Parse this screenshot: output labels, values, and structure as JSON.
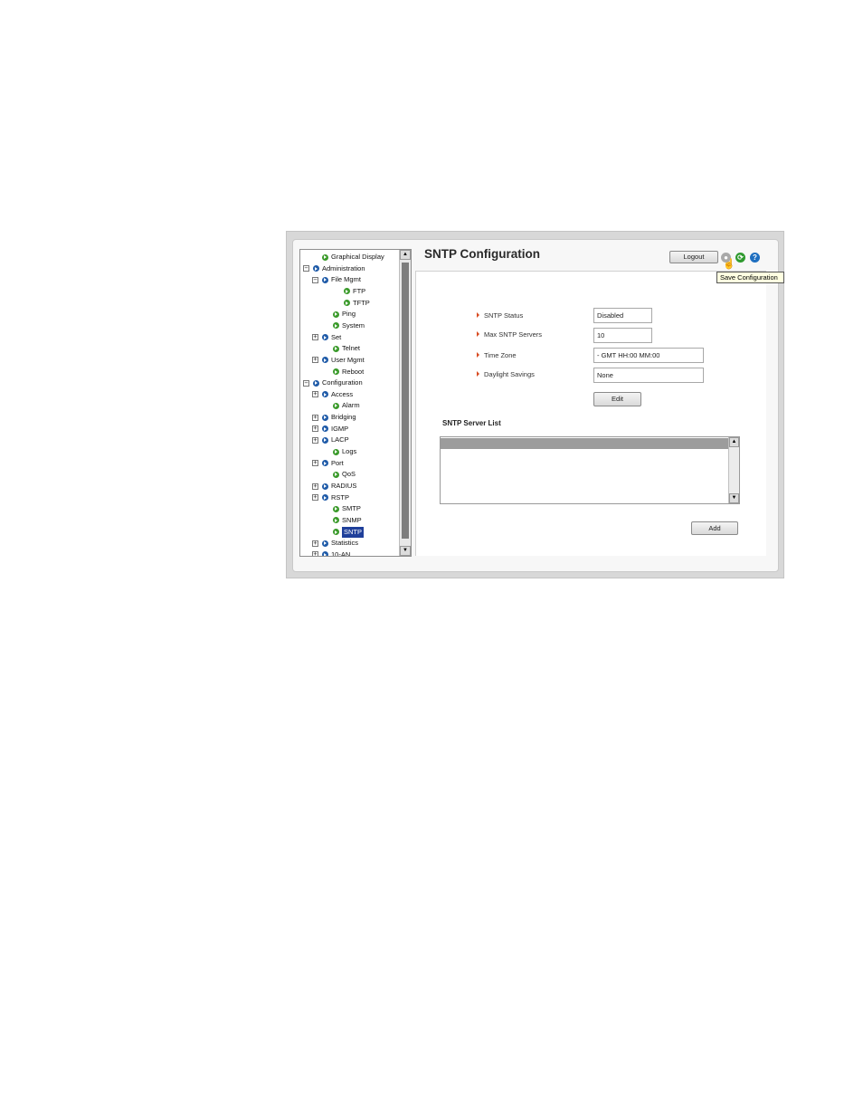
{
  "nav": {
    "items": [
      {
        "label": "Graphical Display",
        "expander": "",
        "bullet": "green",
        "level": 1
      },
      {
        "label": "Administration",
        "expander": "⊟",
        "bullet": "blue",
        "level": 0
      },
      {
        "label": "File Mgmt",
        "expander": "⊟",
        "bullet": "blue",
        "level": 1
      },
      {
        "label": "FTP",
        "expander": "",
        "bullet": "green",
        "level": 3
      },
      {
        "label": "TFTP",
        "expander": "",
        "bullet": "green",
        "level": 3
      },
      {
        "label": "Ping",
        "expander": "",
        "bullet": "green",
        "level": 2
      },
      {
        "label": "System",
        "expander": "",
        "bullet": "green",
        "level": 2
      },
      {
        "label": "Set",
        "expander": "⊞",
        "bullet": "blue",
        "level": 1
      },
      {
        "label": "Telnet",
        "expander": "",
        "bullet": "green",
        "level": 2
      },
      {
        "label": "User Mgmt",
        "expander": "⊞",
        "bullet": "blue",
        "level": 1
      },
      {
        "label": "Reboot",
        "expander": "",
        "bullet": "green",
        "level": 2
      },
      {
        "label": "Configuration",
        "expander": "⊟",
        "bullet": "blue",
        "level": 0
      },
      {
        "label": "Access",
        "expander": "⊞",
        "bullet": "blue",
        "level": 1
      },
      {
        "label": "Alarm",
        "expander": "",
        "bullet": "green",
        "level": 2
      },
      {
        "label": "Bridging",
        "expander": "⊞",
        "bullet": "blue",
        "level": 1
      },
      {
        "label": "IGMP",
        "expander": "⊞",
        "bullet": "blue",
        "level": 1
      },
      {
        "label": "LACP",
        "expander": "⊞",
        "bullet": "blue",
        "level": 1
      },
      {
        "label": "Logs",
        "expander": "",
        "bullet": "green",
        "level": 2
      },
      {
        "label": "Port",
        "expander": "⊞",
        "bullet": "blue",
        "level": 1
      },
      {
        "label": "QoS",
        "expander": "",
        "bullet": "green",
        "level": 2
      },
      {
        "label": "RADIUS",
        "expander": "⊞",
        "bullet": "blue",
        "level": 1
      },
      {
        "label": "RSTP",
        "expander": "⊞",
        "bullet": "blue",
        "level": 1
      },
      {
        "label": "SMTP",
        "expander": "",
        "bullet": "green",
        "level": 2
      },
      {
        "label": "SNMP",
        "expander": "",
        "bullet": "green",
        "level": 2
      },
      {
        "label": "SNTP",
        "expander": "",
        "bullet": "green",
        "level": 2,
        "selected": true
      },
      {
        "label": "Statistics",
        "expander": "⊞",
        "bullet": "blue",
        "level": 1
      },
      {
        "label": "10-AN",
        "expander": "⊞",
        "bullet": "blue",
        "level": 1
      }
    ]
  },
  "header": {
    "title": "SNTP Configuration",
    "logout_label": "Logout",
    "tooltip": "Save Configuration"
  },
  "fields": [
    {
      "label": "SNTP Status",
      "value": "Disabled"
    },
    {
      "label": "Max SNTP Servers",
      "value": "10"
    },
    {
      "label": "Time Zone",
      "value": "- GMT HH:00 MM:00"
    },
    {
      "label": "Daylight Savings",
      "value": "None"
    }
  ],
  "edit_label": "Edit",
  "server_list": {
    "title": "SNTP Server List",
    "add_label": "Add"
  },
  "colors": {
    "accent_arrow": "#d84a20",
    "selected_nav": "#1f3f9a",
    "bullet_green": "#3a9a2a",
    "bullet_blue": "#1f5ba8"
  }
}
